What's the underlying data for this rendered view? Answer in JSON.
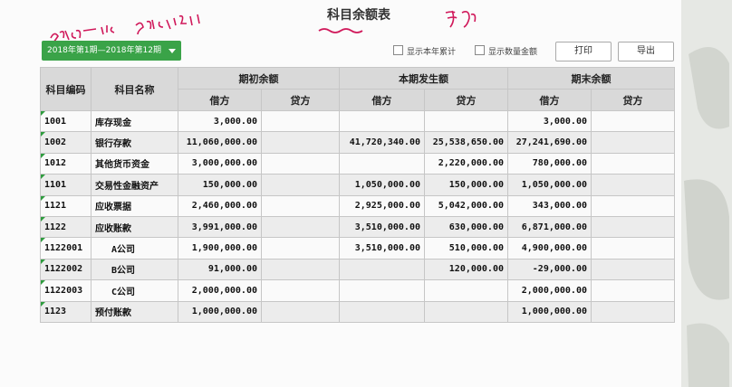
{
  "title": "科目余额表",
  "handwriting": {
    "date_range": "2018.1.1 — 2018.12.31",
    "note": "手J"
  },
  "toolbar": {
    "period": "2018年第1期—2018年第12期",
    "show_year_total": "显示本年累计",
    "show_qty_amount": "显示数量金额",
    "print": "打印",
    "export": "导出"
  },
  "table": {
    "headers": {
      "code": "科目编码",
      "name": "科目名称",
      "opening": "期初余额",
      "current": "本期发生额",
      "closing": "期末余额",
      "debit": "借方",
      "credit": "贷方"
    },
    "rows": [
      {
        "code": "1001",
        "name": "库存现金",
        "sub": false,
        "od": "3,000.00",
        "oc": "",
        "cd": "",
        "cc": "",
        "ed": "3,000.00",
        "ec": ""
      },
      {
        "code": "1002",
        "name": "银行存款",
        "sub": false,
        "od": "11,060,000.00",
        "oc": "",
        "cd": "41,720,340.00",
        "cc": "25,538,650.00",
        "ed": "27,241,690.00",
        "ec": ""
      },
      {
        "code": "1012",
        "name": "其他货币资金",
        "sub": false,
        "od": "3,000,000.00",
        "oc": "",
        "cd": "",
        "cc": "2,220,000.00",
        "ed": "780,000.00",
        "ec": ""
      },
      {
        "code": "1101",
        "name": "交易性金融资产",
        "sub": false,
        "od": "150,000.00",
        "oc": "",
        "cd": "1,050,000.00",
        "cc": "150,000.00",
        "ed": "1,050,000.00",
        "ec": ""
      },
      {
        "code": "1121",
        "name": "应收票据",
        "sub": false,
        "od": "2,460,000.00",
        "oc": "",
        "cd": "2,925,000.00",
        "cc": "5,042,000.00",
        "ed": "343,000.00",
        "ec": ""
      },
      {
        "code": "1122",
        "name": "应收账款",
        "sub": false,
        "od": "3,991,000.00",
        "oc": "",
        "cd": "3,510,000.00",
        "cc": "630,000.00",
        "ed": "6,871,000.00",
        "ec": ""
      },
      {
        "code": "1122001",
        "name": "A公司",
        "sub": true,
        "od": "1,900,000.00",
        "oc": "",
        "cd": "3,510,000.00",
        "cc": "510,000.00",
        "ed": "4,900,000.00",
        "ec": ""
      },
      {
        "code": "1122002",
        "name": "B公司",
        "sub": true,
        "od": "91,000.00",
        "oc": "",
        "cd": "",
        "cc": "120,000.00",
        "ed": "-29,000.00",
        "ec": ""
      },
      {
        "code": "1122003",
        "name": "C公司",
        "sub": true,
        "od": "2,000,000.00",
        "oc": "",
        "cd": "",
        "cc": "",
        "ed": "2,000,000.00",
        "ec": ""
      },
      {
        "code": "1123",
        "name": "预付账款",
        "sub": false,
        "od": "1,000,000.00",
        "oc": "",
        "cd": "",
        "cc": "",
        "ed": "1,000,000.00",
        "ec": ""
      }
    ]
  }
}
